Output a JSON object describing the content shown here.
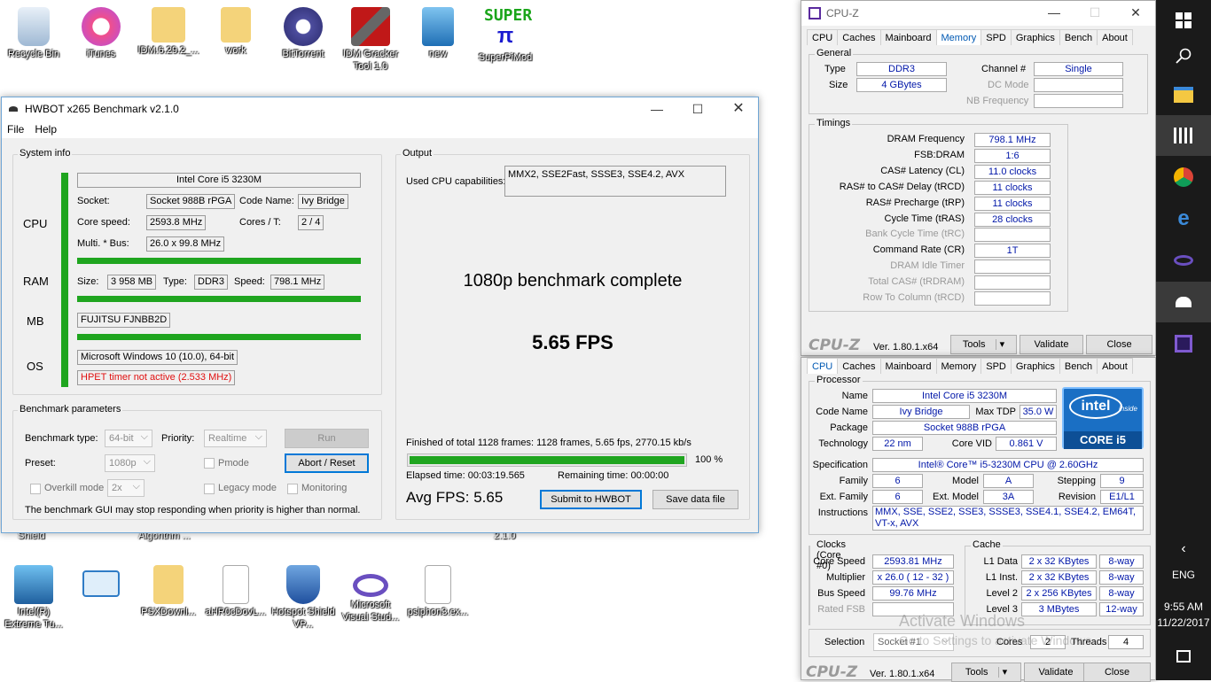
{
  "desktop": {
    "icons_top": [
      "Recycle Bin",
      "iTunes",
      "IDM.6.29.2_...",
      "work",
      "BitTorrent",
      "IDM Gracker Tool 1.0",
      "new",
      "SuperPiMod"
    ],
    "super_label": "SUPER",
    "super_pi": "π",
    "partial_labels": [
      "Shield",
      "Algorithm ...",
      "2.1.0"
    ],
    "icons_bottom": [
      "Intel(R) Extreme Tu...",
      "",
      "PSXDownl...",
      "aHR0cDovL...",
      "Hotspot Shield VP...",
      "Microsoft Visual Stud...",
      "psiphon3.ex..."
    ],
    "watermark_title": "Activate Windows",
    "watermark_sub": "Go to Settings to activate Windows."
  },
  "hwbot": {
    "title": "HWBOT x265 Benchmark v2.1.0",
    "menu": [
      "File",
      "Help"
    ],
    "sysinfo": {
      "group": "System info",
      "cpu_label": "CPU",
      "ram_label": "RAM",
      "mb_label": "MB",
      "os_label": "OS",
      "cpu_name": "Intel Core i5 3230M",
      "socket_label": "Socket:",
      "socket": "Socket 988B rPGA",
      "codename_label": "Code Name:",
      "codename": "Ivy Bridge",
      "corespeed_label": "Core speed:",
      "corespeed": "2593.8 MHz",
      "cores_label": "Cores / T:",
      "cores": "2 / 4",
      "multi_label": "Multi. * Bus:",
      "multi": "26.0 x 99.8 MHz",
      "size_label": "Size:",
      "size": "3 958 MB",
      "type_label": "Type:",
      "type": "DDR3",
      "speed_label": "Speed:",
      "speed": "798.1 MHz",
      "mb": "FUJITSU FJNBB2D",
      "os": "Microsoft Windows 10 (10.0), 64-bit",
      "hpet": "HPET timer not active (2.533 MHz)"
    },
    "params": {
      "group": "Benchmark parameters",
      "bench_type_label": "Benchmark type:",
      "bench_type": "64-bit",
      "priority_label": "Priority:",
      "priority": "Realtime",
      "run": "Run",
      "preset_label": "Preset:",
      "preset": "1080p",
      "pmode": "Pmode",
      "abort": "Abort / Reset",
      "overkill": "Overkill mode",
      "overkill_val": "2x",
      "legacy": "Legacy mode",
      "monitoring": "Monitoring",
      "warning": "The benchmark GUI may stop responding when priority is higher than normal."
    },
    "output": {
      "group": "Output",
      "caps_label": "Used CPU capabilities:",
      "caps": "MMX2, SSE2Fast, SSSE3, SSE4.2, AVX",
      "status": "1080p benchmark complete",
      "fps": "5.65 FPS",
      "finished": "Finished of total 1128 frames: 1128 frames, 5.65 fps,   2770.15 kb/s",
      "progress": 1.0,
      "progress_label": "100 %",
      "elapsed": "Elapsed time: 00:03:19.565",
      "remaining": "Remaining time: 00:00:00",
      "avg": "Avg FPS: 5.65",
      "submit": "Submit to HWBOT",
      "save": "Save data file"
    }
  },
  "cpuz_mem": {
    "title": "CPU-Z",
    "tabs": [
      "CPU",
      "Caches",
      "Mainboard",
      "Memory",
      "SPD",
      "Graphics",
      "Bench",
      "About"
    ],
    "general": "General",
    "type_label": "Type",
    "type": "DDR3",
    "size_label": "Size",
    "size": "4 GBytes",
    "channel_label": "Channel #",
    "channel": "Single",
    "dc_label": "DC Mode",
    "nb_label": "NB Frequency",
    "timings": "Timings",
    "rows": [
      {
        "label": "DRAM Frequency",
        "value": "798.1 MHz",
        "dim": false
      },
      {
        "label": "FSB:DRAM",
        "value": "1:6",
        "dim": false
      },
      {
        "label": "CAS# Latency (CL)",
        "value": "11.0 clocks",
        "dim": false
      },
      {
        "label": "RAS# to CAS# Delay (tRCD)",
        "value": "11 clocks",
        "dim": false
      },
      {
        "label": "RAS# Precharge (tRP)",
        "value": "11 clocks",
        "dim": false
      },
      {
        "label": "Cycle Time (tRAS)",
        "value": "28 clocks",
        "dim": false
      },
      {
        "label": "Bank Cycle Time (tRC)",
        "value": "",
        "dim": true
      },
      {
        "label": "Command Rate (CR)",
        "value": "1T",
        "dim": false
      },
      {
        "label": "DRAM Idle Timer",
        "value": "",
        "dim": true
      },
      {
        "label": "Total CAS# (tRDRAM)",
        "value": "",
        "dim": true
      },
      {
        "label": "Row To Column (tRCD)",
        "value": "",
        "dim": true
      }
    ],
    "logo": "CPU-Z",
    "version": "Ver. 1.80.1.x64",
    "tools": "Tools",
    "validate": "Validate",
    "close": "Close"
  },
  "cpuz_cpu": {
    "tabs": [
      "CPU",
      "Caches",
      "Mainboard",
      "Memory",
      "SPD",
      "Graphics",
      "Bench",
      "About"
    ],
    "processor": "Processor",
    "name_label": "Name",
    "name": "Intel Core i5 3230M",
    "codename_label": "Code Name",
    "codename": "Ivy Bridge",
    "tdp_label": "Max TDP",
    "tdp": "35.0 W",
    "package_label": "Package",
    "package": "Socket 988B rPGA",
    "tech_label": "Technology",
    "tech": "22 nm",
    "vid_label": "Core VID",
    "vid": "0.861 V",
    "spec_label": "Specification",
    "spec": "Intel® Core™ i5-3230M CPU @ 2.60GHz",
    "family_label": "Family",
    "family": "6",
    "model_label": "Model",
    "model": "A",
    "stepping_label": "Stepping",
    "stepping": "9",
    "extfam_label": "Ext. Family",
    "extfam": "6",
    "extmodel_label": "Ext. Model",
    "extmodel": "3A",
    "revision_label": "Revision",
    "revision": "E1/L1",
    "instr_label": "Instructions",
    "instr": "MMX, SSE, SSE2, SSE3, SSSE3, SSE4.1, SSE4.2, EM64T, VT-x, AVX",
    "intel_word": "intel",
    "intel_inside": "inside",
    "intel_core": "CORE i5",
    "clocks": "Clocks (Core #0)",
    "corespeed_label": "Core Speed",
    "corespeed": "2593.81 MHz",
    "mult_label": "Multiplier",
    "mult": "x 26.0 ( 12 - 32 )",
    "bus_label": "Bus Speed",
    "bus": "99.76 MHz",
    "fsb_label": "Rated FSB",
    "cache": "Cache",
    "l1d_label": "L1 Data",
    "l1d": "2 x 32 KBytes",
    "l1d_way": "8-way",
    "l1i_label": "L1 Inst.",
    "l1i": "2 x 32 KBytes",
    "l1i_way": "8-way",
    "l2_label": "Level 2",
    "l2": "2 x 256 KBytes",
    "l2_way": "8-way",
    "l3_label": "Level 3",
    "l3": "3 MBytes",
    "l3_way": "12-way",
    "selection_label": "Selection",
    "selection": "Socket #1",
    "cores_label": "Cores",
    "cores": "2",
    "threads_label": "Threads",
    "threads": "4",
    "logo": "CPU-Z",
    "version": "Ver. 1.80.1.x64",
    "tools": "Tools",
    "validate": "Validate",
    "close": "Close"
  },
  "taskbar": {
    "lang": "ENG",
    "time": "9:55 AM",
    "date": "11/22/2017",
    "colors": {
      "bg": "#1a1a1a",
      "accent": "#1fa51f"
    }
  }
}
